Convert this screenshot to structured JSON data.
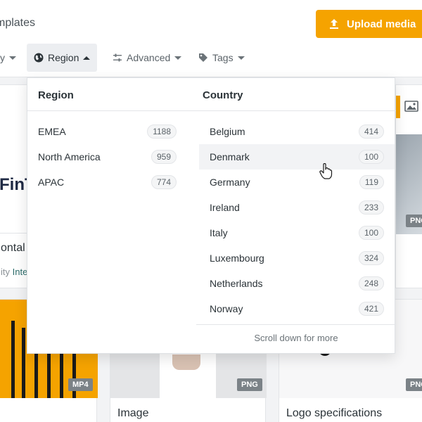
{
  "header": {
    "title": "mplates",
    "upload_label": "Upload media"
  },
  "filters": {
    "cutoff_label": "y",
    "region_label": "Region",
    "advanced_label": "Advanced",
    "tags_label": "Tags"
  },
  "cards": {
    "card1_title": "ontal",
    "card1_sub_a": "ity ",
    "card1_sub_b": "Inte",
    "card1_logo_text": "FinT",
    "card1_badge": "MP4",
    "card2_title": "Image",
    "card2_badge": "PNG",
    "card3_title": "Logo specifications",
    "card3_badge": "PNG",
    "card_right_badge": "PNG"
  },
  "dropdown": {
    "region_header": "Region",
    "country_header": "Country",
    "regions": [
      {
        "name": "EMEA",
        "count": "1188"
      },
      {
        "name": "North America",
        "count": "959"
      },
      {
        "name": "APAC",
        "count": "774"
      }
    ],
    "countries": [
      {
        "name": "Belgium",
        "count": "414"
      },
      {
        "name": "Denmark",
        "count": "100"
      },
      {
        "name": "Germany",
        "count": "119"
      },
      {
        "name": "Ireland",
        "count": "233"
      },
      {
        "name": "Italy",
        "count": "100"
      },
      {
        "name": "Luxembourg",
        "count": "324"
      },
      {
        "name": "Netherlands",
        "count": "248"
      },
      {
        "name": "Norway",
        "count": "421"
      }
    ],
    "scroll_hint": "Scroll down for more"
  },
  "colors": {
    "accent": "#f5a300",
    "link": "#2d6d6b"
  },
  "icons": [
    "upload-icon",
    "globe-icon",
    "sliders-icon",
    "tag-icon",
    "image-icon",
    "hand-cursor-icon"
  ]
}
